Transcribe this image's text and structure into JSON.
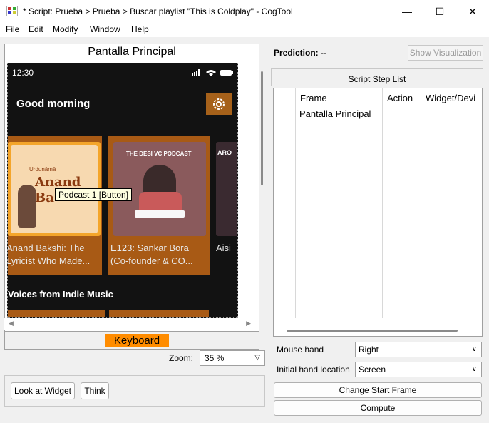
{
  "window": {
    "title": "* Script: Prueba > Prueba > Buscar playlist \"This is Coldplay\" - CogTool",
    "min_icon": "minimize-icon",
    "max_icon": "maximize-icon",
    "close_icon": "close-icon"
  },
  "menu": [
    "File",
    "Edit",
    "Modify",
    "Window",
    "Help"
  ],
  "frame": {
    "title": "Pantalla Principal",
    "phone": {
      "time": "12:30",
      "greeting": "Good morning",
      "cards": [
        {
          "caption1": "Anand Bakshi: The",
          "caption2": "Lyricist Who Made...",
          "art_text1": "Urdunāmā",
          "art_text2": "Anand",
          "art_text3": "Ba"
        },
        {
          "caption1": "E123: Sankar Bora",
          "caption2": "(Co-founder & CO...",
          "art_text1": "THE DESI VC PODCAST"
        },
        {
          "caption1": "Aisi",
          "caption2": "",
          "art_text1": "ARO"
        }
      ],
      "section_title": "Voices from Indie Music"
    },
    "tooltip": "Podcast 1 [Button]",
    "keyboard_label": "Keyboard"
  },
  "zoom": {
    "label": "Zoom:",
    "value": "35 %"
  },
  "buttons": {
    "look_at_widget": "Look at Widget",
    "think": "Think"
  },
  "prediction": {
    "label": "Prediction:",
    "value": "--",
    "show_viz": "Show Visualization"
  },
  "script_steps": {
    "title": "Script Step List",
    "columns": [
      "Frame",
      "Action",
      "Widget/Devi"
    ],
    "rows": [
      {
        "frame": "Pantalla Principal",
        "action": "",
        "widget": ""
      }
    ]
  },
  "settings": {
    "mouse_hand_label": "Mouse hand",
    "mouse_hand_value": "Right",
    "initial_hand_label": "Initial hand location",
    "initial_hand_value": "Screen"
  },
  "actions": {
    "change_start_frame": "Change Start Frame",
    "compute": "Compute"
  },
  "colors": {
    "accent_orange": "#ff8c00",
    "card_brown": "#a85a15",
    "phone_bg": "#121212"
  }
}
